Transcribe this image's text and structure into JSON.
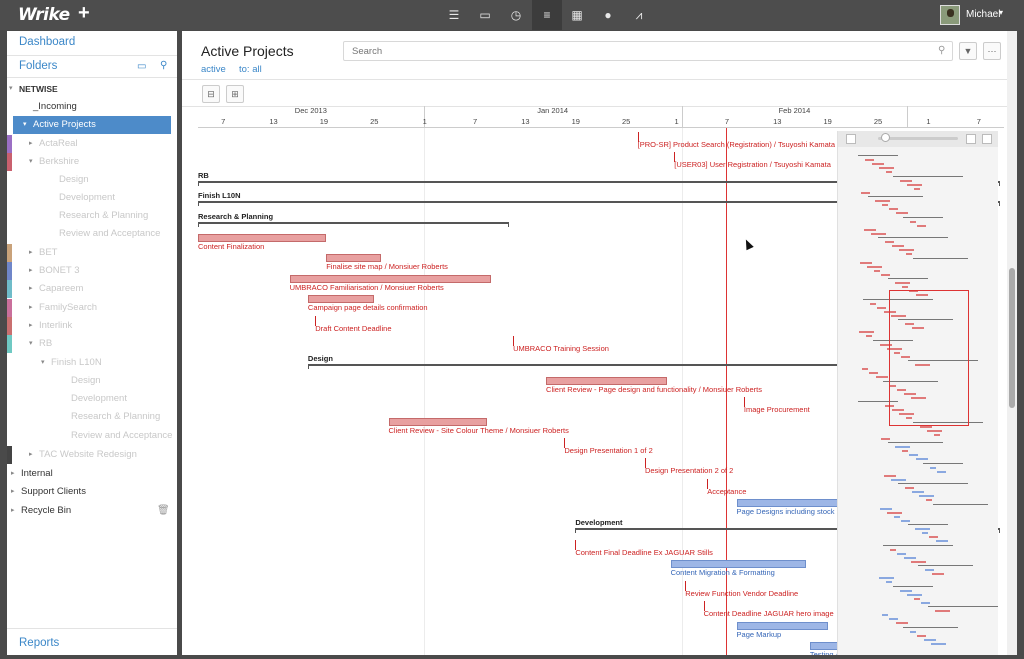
{
  "app": {
    "logo": "Wrike",
    "plus": "+",
    "username": "Michael"
  },
  "nav_icons": [
    {
      "name": "menu-icon",
      "glyph": "☰"
    },
    {
      "name": "inbox-icon",
      "glyph": "▭"
    },
    {
      "name": "clock-icon",
      "glyph": "◷"
    },
    {
      "name": "gantt-icon",
      "glyph": "≡"
    },
    {
      "name": "table-icon",
      "glyph": "▦"
    },
    {
      "name": "person-icon",
      "glyph": "●"
    },
    {
      "name": "chart-icon",
      "glyph": "⩘"
    }
  ],
  "sidebar": {
    "dashboard": "Dashboard",
    "folders": "Folders",
    "reports": "Reports",
    "tree": [
      {
        "label": "NETWISE",
        "level": 0,
        "twisty": "▾",
        "bold": true
      },
      {
        "label": "_Incoming",
        "level": 1
      },
      {
        "label": "Active Projects",
        "level": 1,
        "twisty": "▾",
        "selected": true
      },
      {
        "label": "ActaReal",
        "level": 2,
        "twisty": "▸",
        "dim": true,
        "color": "#9b6fc4"
      },
      {
        "label": "Berkshire",
        "level": 2,
        "twisty": "▾",
        "dim": true,
        "color": "#c9606e"
      },
      {
        "label": "Design",
        "level": 3,
        "dim": true
      },
      {
        "label": "Development",
        "level": 3,
        "dim": true
      },
      {
        "label": "Research & Planning",
        "level": 3,
        "dim": true
      },
      {
        "label": "Review and Acceptance",
        "level": 3,
        "dim": true
      },
      {
        "label": "BET",
        "level": 2,
        "twisty": "▸",
        "dim": true,
        "color": "#c9a27a"
      },
      {
        "label": "BONET 3",
        "level": 2,
        "twisty": "▸",
        "dim": true,
        "color": "#6f86c9"
      },
      {
        "label": "Capareem",
        "level": 2,
        "twisty": "▸",
        "dim": true,
        "color": "#6fbcc9"
      },
      {
        "label": "FamilySearch",
        "level": 2,
        "twisty": "▸",
        "dim": true,
        "color": "#c96f9b"
      },
      {
        "label": "Interlink",
        "level": 2,
        "twisty": "▸",
        "dim": true,
        "color": "#c96f6f"
      },
      {
        "label": "RB",
        "level": 2,
        "twisty": "▾",
        "dim": true,
        "color": "#6fc9c3"
      },
      {
        "label": "Finish L10N",
        "level": 3,
        "twisty": "▾",
        "dim": true
      },
      {
        "label": "Design",
        "level": 4,
        "dim": true
      },
      {
        "label": "Development",
        "level": 4,
        "dim": true
      },
      {
        "label": "Research & Planning",
        "level": 4,
        "dim": true
      },
      {
        "label": "Review and Acceptance",
        "level": 4,
        "dim": true
      },
      {
        "label": "TAC Website Redesign",
        "level": 2,
        "twisty": "▸",
        "dim": true,
        "color": "#444444"
      },
      {
        "label": "Internal",
        "level": 0,
        "twisty": "▸"
      },
      {
        "label": "Support Clients",
        "level": 0,
        "twisty": "▸"
      },
      {
        "label": "Recycle Bin",
        "level": 0,
        "twisty": "▸"
      }
    ]
  },
  "main": {
    "title": "Active Projects",
    "filter_active": "active",
    "filter_to": "to: all",
    "search_placeholder": "Search"
  },
  "timeline": {
    "months": [
      {
        "label": "Dec 2013",
        "start": 0,
        "end": 7
      },
      {
        "label": "Jan 2014",
        "start": 7,
        "end": 15
      },
      {
        "label": "Feb 2014",
        "start": 15,
        "end": 22
      },
      {
        "label": "",
        "start": 22,
        "end": 25
      }
    ],
    "days": [
      "7",
      "13",
      "19",
      "25",
      "1",
      "7",
      "13",
      "19",
      "25",
      "1",
      "7",
      "13",
      "19",
      "25",
      "1",
      "7"
    ]
  },
  "gantt": {
    "colors": {
      "task": "#e8a0a0",
      "task_border": "#c46a6a",
      "text": "#cc2222",
      "blue": "#9db6e6",
      "blue_text": "#3566b7"
    },
    "items": [
      {
        "label": "[PRO-SR] Product Search (Registration) / Tsuyoshi Kamata",
        "kind": "milestone",
        "start": 12.0,
        "row": 0
      },
      {
        "label": "[USER03] User Registration / Tsuyoshi Kamata",
        "kind": "milestone",
        "start": 13.0,
        "row": 1
      },
      {
        "label": "RB",
        "kind": "group",
        "start": 0,
        "end": 21.9,
        "row": 2
      },
      {
        "label": "Finish L10N",
        "kind": "group",
        "start": 0,
        "end": 21.9,
        "row": 3
      },
      {
        "label": "Research & Planning",
        "kind": "group",
        "start": 0,
        "end": 8.5,
        "row": 4
      },
      {
        "label": "Content Finalization",
        "kind": "task",
        "start": 0,
        "end": 3.5,
        "row": 5
      },
      {
        "label": "Finalise site map / Monsiuer Roberts",
        "kind": "task",
        "start": 3.5,
        "end": 5.0,
        "row": 6
      },
      {
        "label": "UMBRACO Familiarisation / Monsiuer Roberts",
        "kind": "task",
        "start": 2.5,
        "end": 8.0,
        "row": 7
      },
      {
        "label": "Campaign page details confirmation",
        "kind": "task",
        "start": 3.0,
        "end": 4.8,
        "row": 8
      },
      {
        "label": "Draft Content Deadline",
        "kind": "milestone",
        "start": 3.2,
        "row": 9
      },
      {
        "label": "UMBRACO Training Session",
        "kind": "milestone",
        "start": 8.6,
        "row": 10
      },
      {
        "label": "Design",
        "kind": "group",
        "start": 3.0,
        "end": 18.4,
        "row": 11
      },
      {
        "label": "Client Review - Page design and functionality / Monsiuer Roberts",
        "kind": "task",
        "start": 9.5,
        "end": 12.8,
        "row": 12
      },
      {
        "label": "Image Procurement",
        "kind": "milestone",
        "start": 14.9,
        "row": 13
      },
      {
        "label": "Client Review - Site Colour Theme / Monsiuer Roberts",
        "kind": "task",
        "start": 5.2,
        "end": 7.9,
        "row": 14
      },
      {
        "label": "Design Presentation 1 of 2",
        "kind": "milestone",
        "start": 10.0,
        "row": 15
      },
      {
        "label": "Design Presentation 2 of 2",
        "kind": "milestone",
        "start": 12.2,
        "row": 16
      },
      {
        "label": "Acceptance",
        "kind": "milestone",
        "start": 13.9,
        "row": 17
      },
      {
        "label": "Page Designs including stock image selection / Michael R",
        "kind": "task",
        "blue": true,
        "start": 14.7,
        "end": 18.4,
        "row": 18
      },
      {
        "label": "Development",
        "kind": "group",
        "start": 10.3,
        "end": 21.9,
        "row": 19
      },
      {
        "label": "Content Final Deadline Ex JAGUAR Stills",
        "kind": "milestone",
        "start": 10.3,
        "row": 20
      },
      {
        "label": "Content Migration & Formatting",
        "kind": "task",
        "blue": true,
        "start": 12.9,
        "end": 16.6,
        "row": 21
      },
      {
        "label": "Review Function Vendor Deadline",
        "kind": "milestone",
        "start": 13.3,
        "row": 22
      },
      {
        "label": "Content Deadline JAGUAR hero image",
        "kind": "milestone",
        "start": 13.8,
        "row": 23
      },
      {
        "label": "Page Markup",
        "kind": "task",
        "blue": true,
        "start": 14.7,
        "end": 17.2,
        "row": 24
      },
      {
        "label": "Testing & Adjustment",
        "kind": "task",
        "blue": true,
        "start": 16.7,
        "end": 18.9,
        "row": 25
      }
    ]
  }
}
